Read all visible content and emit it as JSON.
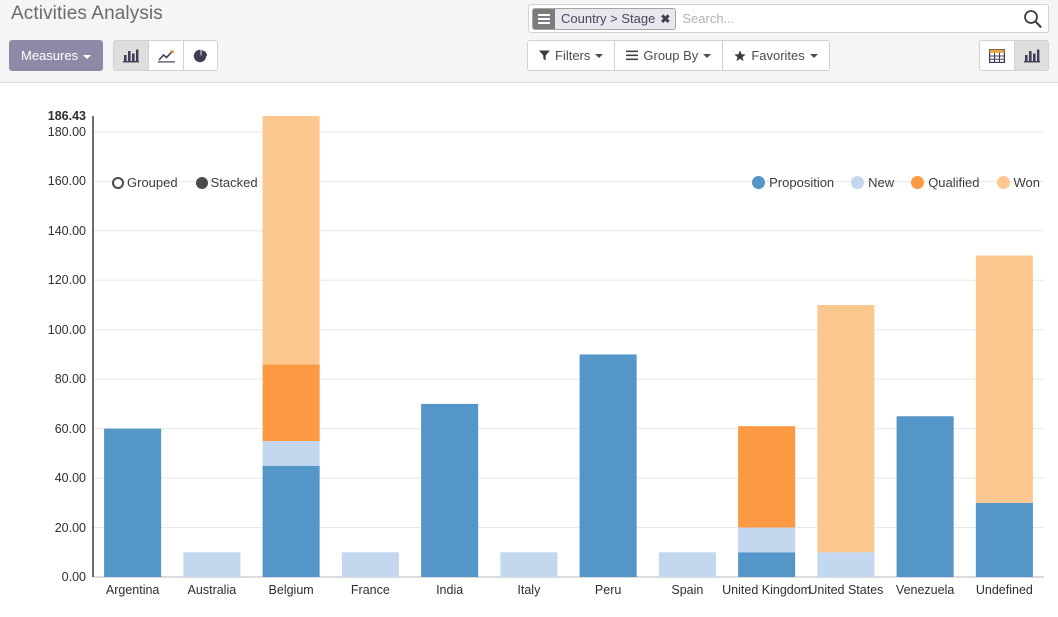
{
  "header": {
    "title": "Activities Analysis",
    "measures_label": "Measures",
    "view_modes": [
      {
        "name": "bar-chart-icon",
        "label": "Bar Chart",
        "active": true
      },
      {
        "name": "line-chart-icon",
        "label": "Line Chart",
        "active": false
      },
      {
        "name": "pie-chart-icon",
        "label": "Pie Chart",
        "active": false
      }
    ]
  },
  "search": {
    "facet_label": "Country > Stage",
    "facet_icon": "group-by-icon",
    "facet_remove_label": "✖",
    "placeholder": "Search...",
    "value": "",
    "search_icon": "search-icon"
  },
  "filters": {
    "buttons": [
      {
        "label": "Filters",
        "icon": "filter-icon"
      },
      {
        "label": "Group By",
        "icon": "group-by-icon"
      },
      {
        "label": "Favorites",
        "icon": "star-icon"
      }
    ]
  },
  "view_switcher": [
    {
      "name": "pivot-view-icon",
      "label": "Pivot",
      "active": false
    },
    {
      "name": "graph-view-icon",
      "label": "Graph",
      "active": true
    }
  ],
  "chart_toggles": [
    {
      "label": "Grouped",
      "checked": false
    },
    {
      "label": "Stacked",
      "checked": true
    }
  ],
  "colors": {
    "proposition": "#5596c8",
    "new": "#c3d8ef",
    "qualified": "#fb9a42",
    "won": "#fdc88f",
    "accent": "#8d8aa8",
    "panel_bg": "#f5f5f5",
    "grid": "#e8e8e8"
  },
  "chart_data": {
    "type": "bar",
    "stacked": true,
    "title": "Activities Analysis",
    "xlabel": "",
    "ylabel": "",
    "ylim": [
      0,
      186.43
    ],
    "grid": true,
    "legend_position": "top-right",
    "y_ticks": [
      "0.00",
      "20.00",
      "40.00",
      "60.00",
      "80.00",
      "100.00",
      "120.00",
      "140.00",
      "160.00",
      "180.00"
    ],
    "y_max_label": "186.43",
    "categories": [
      "Argentina",
      "Australia",
      "Belgium",
      "France",
      "India",
      "Italy",
      "Peru",
      "Spain",
      "United Kingdom",
      "United States",
      "Venezuela",
      "Undefined"
    ],
    "series": [
      {
        "name": "Proposition",
        "color": "#5596c8",
        "values": [
          60,
          0,
          45,
          0,
          70,
          0,
          90,
          0,
          10,
          0,
          65,
          30
        ]
      },
      {
        "name": "New",
        "color": "#c3d8ef",
        "values": [
          0,
          10,
          10,
          10,
          0,
          10,
          0,
          10,
          10,
          10,
          0,
          0
        ]
      },
      {
        "name": "Qualified",
        "color": "#fb9a42",
        "values": [
          0,
          0,
          31,
          0,
          0,
          0,
          0,
          0,
          41,
          0,
          0,
          0
        ]
      },
      {
        "name": "Won",
        "color": "#fdc88f",
        "values": [
          0,
          0,
          100.43,
          0,
          0,
          0,
          0,
          0,
          0,
          100,
          0,
          100
        ]
      }
    ],
    "totals": [
      60,
      10,
      186.43,
      10,
      70,
      10,
      90,
      10,
      61,
      110,
      65,
      130
    ]
  }
}
